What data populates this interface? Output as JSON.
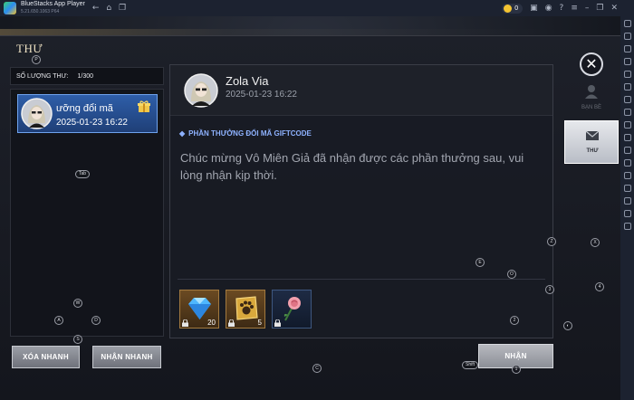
{
  "app": {
    "title": "BlueStacks App Player",
    "version": "5.21.650.1063  P64",
    "coins": "0"
  },
  "screen": {
    "title": "THƯ"
  },
  "mailbox": {
    "count_label": "SỐ LƯỢNG THƯ:",
    "count_value": "1/300",
    "items": [
      {
        "title": "ưỡng đổi mã",
        "date": "2025-01-23 16:22"
      }
    ]
  },
  "detail": {
    "sender": "Zola Via",
    "date": "2025-01-23 16:22",
    "reward_title": "PHẦN THƯỞNG ĐỔI MÃ GIFTCODE",
    "body": "Chúc mừng Vô Miên Giả đã nhận được các phần thưởng sau, vui lòng nhận kịp thời.",
    "attachments": [
      {
        "icon": "diamond-icon",
        "qty": "20"
      },
      {
        "icon": "paw-scroll-icon",
        "qty": "5"
      },
      {
        "icon": "rose-icon",
        "qty": ""
      }
    ]
  },
  "tabs": {
    "friends": "BẠN BÈ",
    "mail": "THƯ"
  },
  "buttons": {
    "delete_quick": "XÓA NHANH",
    "receive_quick": "NHẬN NHANH",
    "receive": "NHẬN"
  },
  "keymap": {
    "p": "P",
    "tab": "Tab",
    "w": "W",
    "a": "A",
    "d": "D",
    "s": "S",
    "c": "C",
    "e": "E",
    "o": "O",
    "z": "Z",
    "x": "X",
    "n3": "3",
    "n4": "4",
    "n2": "2",
    "n1": "1",
    "shift": "Shift"
  },
  "colors": {
    "selected_item": "#2e5ea9",
    "reward_title": "#8eb2ff",
    "body_text": "#a2a6b0"
  }
}
